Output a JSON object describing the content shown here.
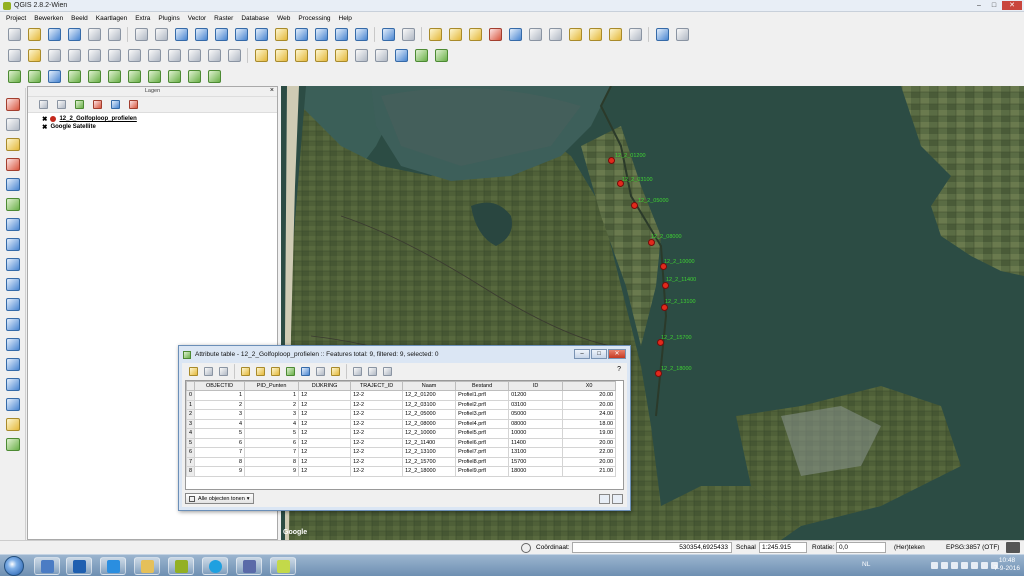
{
  "window": {
    "title": "QGIS 2.8.2-Wien"
  },
  "menu": [
    "Project",
    "Bewerken",
    "Beeld",
    "Kaartlagen",
    "Extra",
    "Plugins",
    "Vector",
    "Raster",
    "Database",
    "Web",
    "Processing",
    "Help"
  ],
  "layers_panel": {
    "title": "Lagen",
    "close": "×",
    "items": [
      {
        "label": "12_2_Golfoploop_profielen",
        "checked": "✖",
        "symbol_color": "#c4281c"
      },
      {
        "label": "Google Satellite",
        "checked": "✖"
      }
    ]
  },
  "map": {
    "attribution": "Google",
    "points": [
      {
        "label": "12_2_01200"
      },
      {
        "label": "12_2_03100"
      },
      {
        "label": "12_2_05000"
      },
      {
        "label": "12_2_08000"
      },
      {
        "label": "12_2_10000"
      },
      {
        "label": "12_2_11400"
      },
      {
        "label": "12_2_13100"
      },
      {
        "label": "12_2_15700"
      },
      {
        "label": "12_2_18000"
      }
    ],
    "label_color": "#3fd233",
    "point_color": "#e12a1c"
  },
  "attribute_table": {
    "title": "Attribute table - 12_2_Golfoploop_profielen :: Features total: 9, filtered: 9, selected: 0",
    "help": "?",
    "columns": [
      "OBJECTID",
      "PID_Punten",
      "DIJKRING",
      "TRAJECT_ID",
      "Naam",
      "Bestand",
      "ID",
      "X0"
    ],
    "rows": [
      {
        "rh": "0",
        "OBJECTID": "1",
        "PID_Punten": "1",
        "DIJKRING": "12",
        "TRAJECT_ID": "12-2",
        "Naam": "12_2_01200",
        "Bestand": "Profiel1.prfl",
        "ID": "01200",
        "X0": "20.00"
      },
      {
        "rh": "1",
        "OBJECTID": "2",
        "PID_Punten": "2",
        "DIJKRING": "12",
        "TRAJECT_ID": "12-2",
        "Naam": "12_2_03100",
        "Bestand": "Profiel2.prfl",
        "ID": "03100",
        "X0": "20.00"
      },
      {
        "rh": "2",
        "OBJECTID": "3",
        "PID_Punten": "3",
        "DIJKRING": "12",
        "TRAJECT_ID": "12-2",
        "Naam": "12_2_05000",
        "Bestand": "Profiel3.prfl",
        "ID": "05000",
        "X0": "24.00"
      },
      {
        "rh": "3",
        "OBJECTID": "4",
        "PID_Punten": "4",
        "DIJKRING": "12",
        "TRAJECT_ID": "12-2",
        "Naam": "12_2_08000",
        "Bestand": "Profiel4.prfl",
        "ID": "08000",
        "X0": "18.00"
      },
      {
        "rh": "4",
        "OBJECTID": "5",
        "PID_Punten": "5",
        "DIJKRING": "12",
        "TRAJECT_ID": "12-2",
        "Naam": "12_2_10000",
        "Bestand": "Profiel5.prfl",
        "ID": "10000",
        "X0": "19.00"
      },
      {
        "rh": "5",
        "OBJECTID": "6",
        "PID_Punten": "6",
        "DIJKRING": "12",
        "TRAJECT_ID": "12-2",
        "Naam": "12_2_11400",
        "Bestand": "Profiel6.prfl",
        "ID": "11400",
        "X0": "20.00"
      },
      {
        "rh": "6",
        "OBJECTID": "7",
        "PID_Punten": "7",
        "DIJKRING": "12",
        "TRAJECT_ID": "12-2",
        "Naam": "12_2_13100",
        "Bestand": "Profiel7.prfl",
        "ID": "13100",
        "X0": "22.00"
      },
      {
        "rh": "7",
        "OBJECTID": "8",
        "PID_Punten": "8",
        "DIJKRING": "12",
        "TRAJECT_ID": "12-2",
        "Naam": "12_2_15700",
        "Bestand": "Profiel8.prfl",
        "ID": "15700",
        "X0": "20.00"
      },
      {
        "rh": "8",
        "OBJECTID": "9",
        "PID_Punten": "9",
        "DIJKRING": "12",
        "TRAJECT_ID": "12-2",
        "Naam": "12_2_18000",
        "Bestand": "Profiel9.prfl",
        "ID": "18000",
        "X0": "21.00"
      }
    ],
    "show_all_label": "Alle objecten tonen"
  },
  "statusbar": {
    "coord_label": "Coördinaat:",
    "coord_value": "530354,6925433",
    "scale_label": "Schaal",
    "scale_value": "1:245.915",
    "rotation_label": "Rotatie:",
    "rotation_value": "0,0",
    "redraw_label": "(Her)teken",
    "crs": "EPSG:3857 (OTF)"
  },
  "taskbar": {
    "language": "NL",
    "time": "10:48",
    "date": "7-9-2016"
  }
}
